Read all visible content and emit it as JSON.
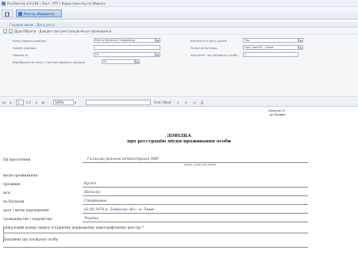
{
  "window": {
    "title": "Роз'Вектор 4.0.294 | Лист : РТГ | Користувач Кусто Микола"
  },
  "ribbon": {
    "button_label": "Реєстр обвидання"
  },
  "breadcrumb": {
    "text": "Головне меню › Дата уміту"
  },
  "doc_title": "Друк/Обрати : Довідка про реєстрацію місця проживання",
  "form": {
    "left": [
      {
        "label": "Кому видано довідку",
        "value": "Кусто Наталія Стефанівна"
      },
      {
        "label": "Номер довідки",
        "value": ""
      },
      {
        "label": "Наявне ат",
        "value": "Ні"
      },
      {
        "label": "Відображати колір з пом'ям видаємо довідки",
        "value": "Ні"
      }
    ],
    "right": [
      {
        "label": "Виписати в базу даних",
        "value": "Так"
      },
      {
        "label": "Розпочи/прізвищ",
        "value": "Про уличі/м - голов"
      },
      {
        "label": "документ що посвідчує особу",
        "value": "1"
      }
    ]
  },
  "toolbar": {
    "page": "1",
    "of": "з 1",
    "zoom": "100%",
    "find_label": "Find | Next"
  },
  "doc": {
    "top_right": "Додаток 13\nдо Правил",
    "heading": "ДОВІДКА",
    "subheading": "про реєстрацію місця проживання особи",
    "issuer_label": "Ця вдостоєння",
    "issuer_value": "Галицька районна адміністрація ЗМР",
    "issuer_caption": "(назва органу реєстрації)",
    "rows": [
      {
        "label": "місце проживання",
        "value": ""
      },
      {
        "label": "прізвище",
        "value": "Кусто"
      },
      {
        "label": "ім'я",
        "value": "Наталія"
      },
      {
        "label": "по батькові",
        "value": "Стефанівна"
      },
      {
        "label": "дата і місце народження",
        "value": "03.08.1970 р. Львівська обл., м. Львів"
      },
      {
        "label": "громадянство / підданство",
        "value": "Україна"
      },
      {
        "label": "унікальний номер запису в Єдиному державному демографічному реєстрі *",
        "value": ""
      }
    ],
    "footer_label": "Документ що посвідчує особу"
  }
}
